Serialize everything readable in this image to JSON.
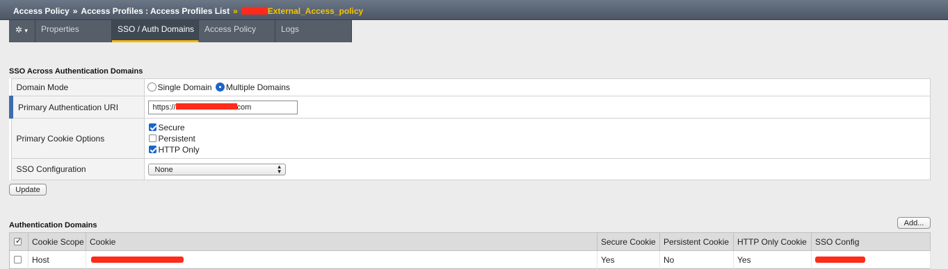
{
  "breadcrumb": {
    "root": "Access Policy",
    "separator": "»",
    "section": "Access Profiles : Access Profiles List",
    "current_sep": "»",
    "current": "External_Access_policy"
  },
  "tabs": {
    "gear_icon": "gear-icon",
    "caret": "▾",
    "items": [
      "Properties",
      "SSO / Auth Domains",
      "Access Policy",
      "Logs"
    ],
    "active": "SSO / Auth Domains"
  },
  "sso": {
    "title": "SSO Across Authentication Domains",
    "domain_mode": {
      "label": "Domain Mode",
      "options": [
        "Single Domain",
        "Multiple Domains"
      ],
      "selected": "Multiple Domains"
    },
    "primary_uri": {
      "label": "Primary Authentication URI",
      "prefix": "https://",
      "suffix": "com"
    },
    "cookie_options": {
      "label": "Primary Cookie Options",
      "secure": {
        "label": "Secure",
        "checked": true
      },
      "persistent": {
        "label": "Persistent",
        "checked": false
      },
      "http_only": {
        "label": "HTTP Only",
        "checked": true
      }
    },
    "sso_config": {
      "label": "SSO Configuration",
      "value": "None"
    },
    "update_label": "Update"
  },
  "auth_domains": {
    "title": "Authentication Domains",
    "add_label": "Add...",
    "columns": [
      "Cookie Scope",
      "Cookie",
      "Secure Cookie",
      "Persistent Cookie",
      "HTTP Only Cookie",
      "SSO Config"
    ],
    "rows": [
      {
        "scope": "Host",
        "secure": "Yes",
        "persistent": "No",
        "http_only": "Yes"
      }
    ]
  },
  "colors": {
    "accent": "#f3b800",
    "selected_blue": "#1b65c9",
    "redaction": "#ff2a1a",
    "header_bg": "#555e69"
  }
}
